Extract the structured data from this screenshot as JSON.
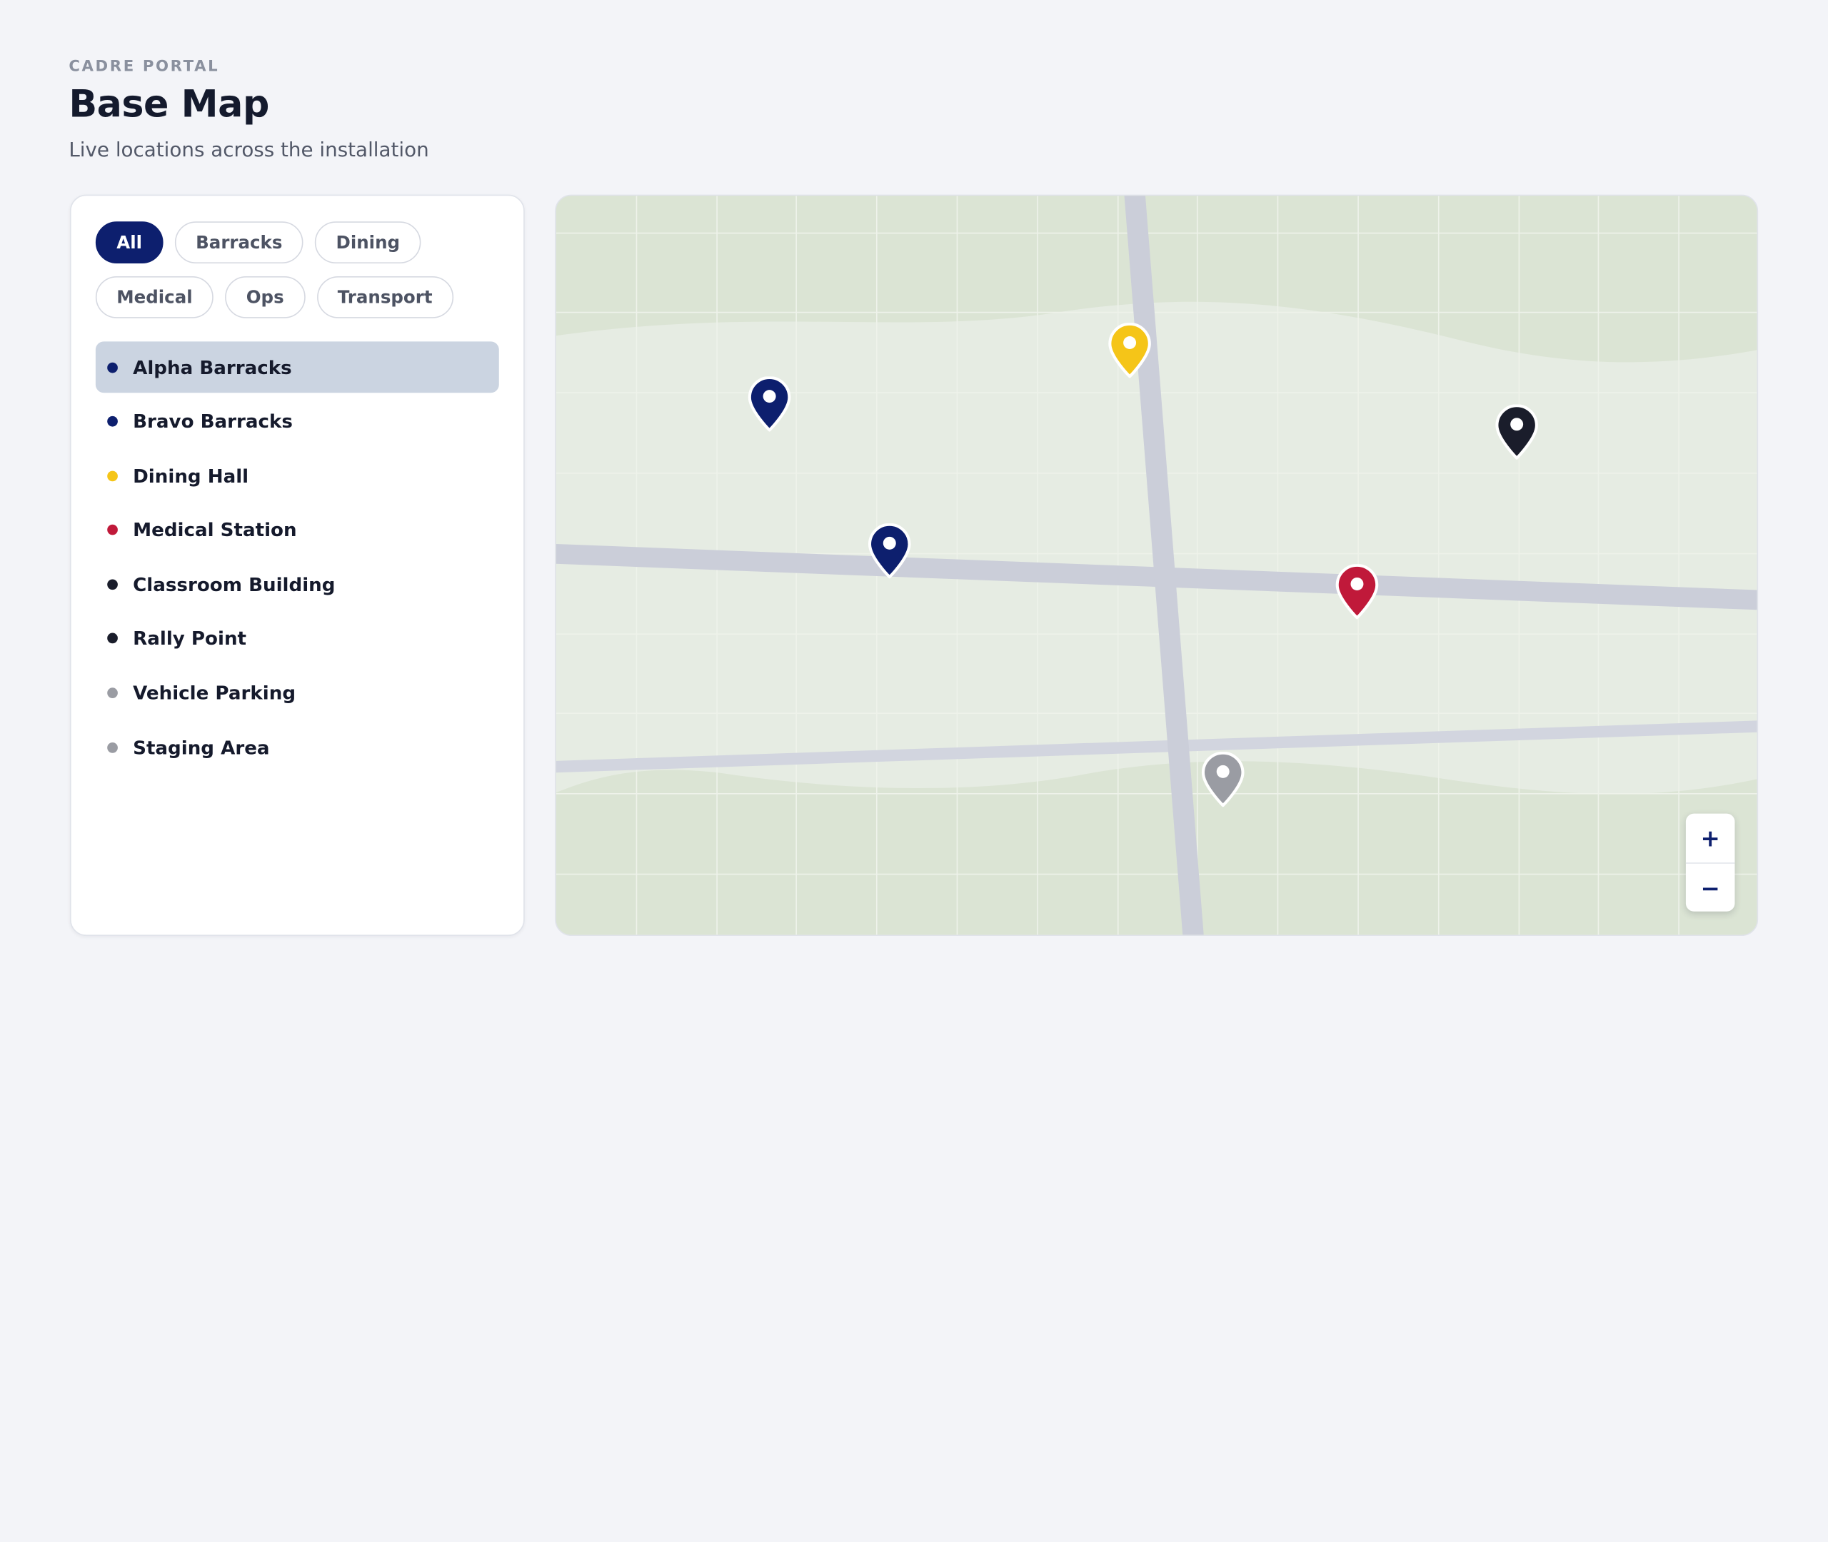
{
  "header": {
    "eyebrow": "CADRE PORTAL",
    "title": "Base Map",
    "subtitle": "Live locations across the installation"
  },
  "filters": [
    {
      "label": "All",
      "active": true
    },
    {
      "label": "Barracks",
      "active": false
    },
    {
      "label": "Dining",
      "active": false
    },
    {
      "label": "Medical",
      "active": false
    },
    {
      "label": "Ops",
      "active": false
    },
    {
      "label": "Transport",
      "active": false
    }
  ],
  "colors": {
    "barracks": "#0d1f6e",
    "dining": "#f5c518",
    "medical": "#c0193a",
    "ops": "#1a1d2b",
    "transport": "#9a9ca3",
    "selected_row": "#cbd4e1"
  },
  "locations": [
    {
      "name": "Alpha Barracks",
      "category": "barracks",
      "color": "#0d1f6e",
      "selected": true
    },
    {
      "name": "Bravo Barracks",
      "category": "barracks",
      "color": "#0d1f6e",
      "selected": false
    },
    {
      "name": "Dining Hall",
      "category": "dining",
      "color": "#f5c518",
      "selected": false
    },
    {
      "name": "Medical Station",
      "category": "medical",
      "color": "#c0193a",
      "selected": false
    },
    {
      "name": "Classroom Building",
      "category": "ops",
      "color": "#1a1d2b",
      "selected": false
    },
    {
      "name": "Rally Point",
      "category": "ops",
      "color": "#1a1d2b",
      "selected": false
    },
    {
      "name": "Vehicle Parking",
      "category": "transport",
      "color": "#9a9ca3",
      "selected": false
    },
    {
      "name": "Staging Area",
      "category": "transport",
      "color": "#9a9ca3",
      "selected": false
    }
  ],
  "map": {
    "zoom_in_label": "+",
    "zoom_out_label": "−",
    "pin_icon": "map-pin-icon"
  }
}
